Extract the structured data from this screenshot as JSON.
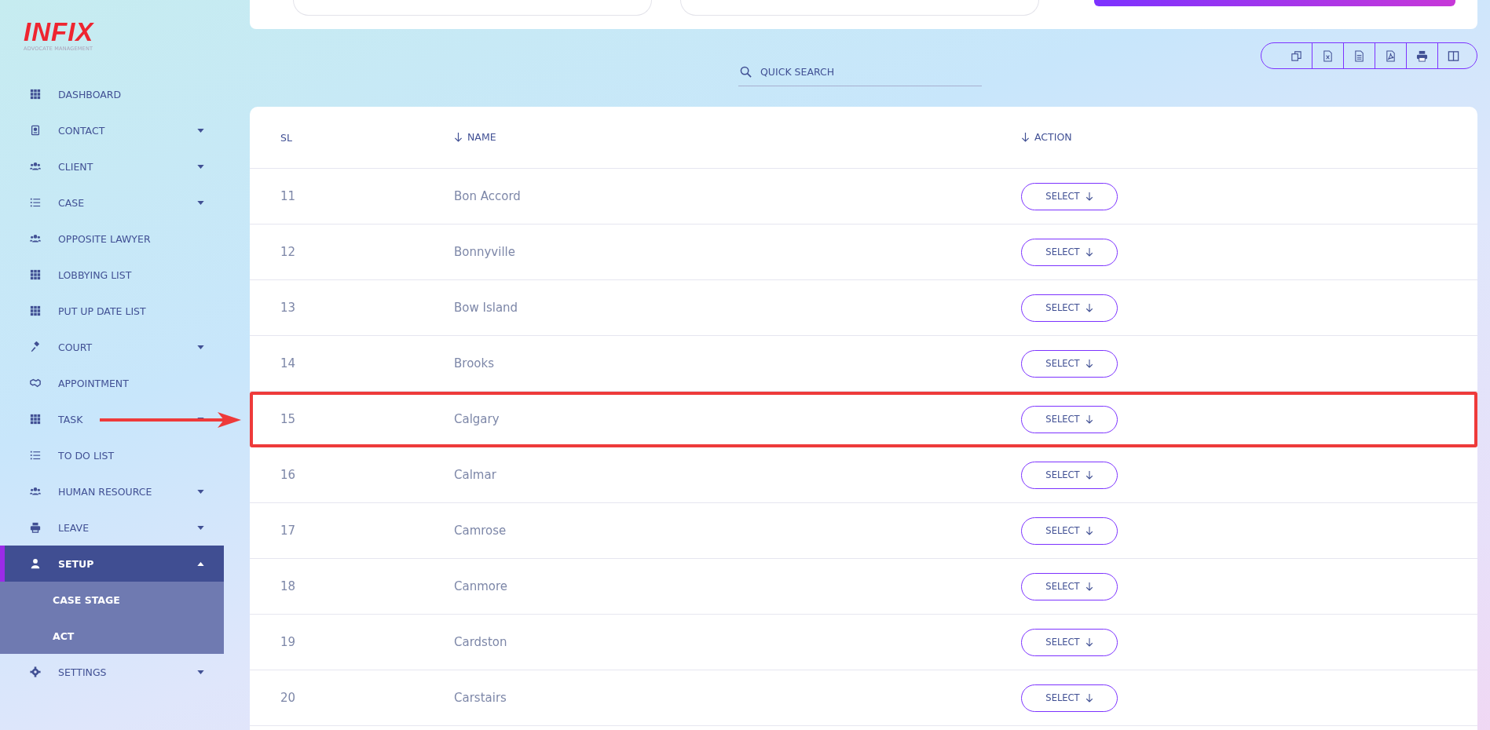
{
  "logo": {
    "name": "INFIX",
    "tagline": "ADVOCATE MANAGEMENT"
  },
  "sidebar": {
    "items": [
      {
        "label": "DASHBOARD",
        "selected": false
      },
      {
        "label": "CONTACT",
        "expanded": false,
        "selected": false
      },
      {
        "label": "CLIENT",
        "expanded": false,
        "selected": false
      },
      {
        "label": "CASE",
        "expanded": false,
        "selected": false
      },
      {
        "label": "OPPOSITE LAWYER",
        "selected": false
      },
      {
        "label": "LOBBYING LIST",
        "selected": false
      },
      {
        "label": "PUT UP DATE LIST",
        "selected": false
      },
      {
        "label": "COURT",
        "expanded": false,
        "selected": false
      },
      {
        "label": "APPOINTMENT",
        "selected": false
      },
      {
        "label": "TASK",
        "expanded": false,
        "selected": false
      },
      {
        "label": "TO DO LIST",
        "selected": false
      },
      {
        "label": "HUMAN RESOURCE",
        "expanded": false,
        "selected": false
      },
      {
        "label": "LEAVE",
        "expanded": false,
        "selected": false
      },
      {
        "label": "SETUP",
        "expanded": true,
        "selected": true,
        "children": [
          {
            "label": "CASE STAGE"
          },
          {
            "label": "ACT"
          }
        ]
      },
      {
        "label": "SETTINGS",
        "expanded": false,
        "selected": false
      }
    ]
  },
  "search": {
    "placeholder": "QUICK SEARCH"
  },
  "table": {
    "columns": [
      {
        "label": "SL",
        "sortable": false
      },
      {
        "label": "NAME",
        "sortable": true
      },
      {
        "label": "ACTION",
        "sortable": true
      }
    ],
    "rows": [
      {
        "sl": "11",
        "name": "Bon Accord",
        "action": "SELECT",
        "highlighted": false
      },
      {
        "sl": "12",
        "name": "Bonnyville",
        "action": "SELECT",
        "highlighted": false
      },
      {
        "sl": "13",
        "name": "Bow Island",
        "action": "SELECT",
        "highlighted": false
      },
      {
        "sl": "14",
        "name": "Brooks",
        "action": "SELECT",
        "highlighted": false
      },
      {
        "sl": "15",
        "name": "Calgary",
        "action": "SELECT",
        "highlighted": true
      },
      {
        "sl": "16",
        "name": "Calmar",
        "action": "SELECT",
        "highlighted": false
      },
      {
        "sl": "17",
        "name": "Camrose",
        "action": "SELECT",
        "highlighted": false
      },
      {
        "sl": "18",
        "name": "Canmore",
        "action": "SELECT",
        "highlighted": false
      },
      {
        "sl": "19",
        "name": "Cardston",
        "action": "SELECT",
        "highlighted": false
      },
      {
        "sl": "20",
        "name": "Carstairs",
        "action": "SELECT",
        "highlighted": false
      }
    ]
  }
}
